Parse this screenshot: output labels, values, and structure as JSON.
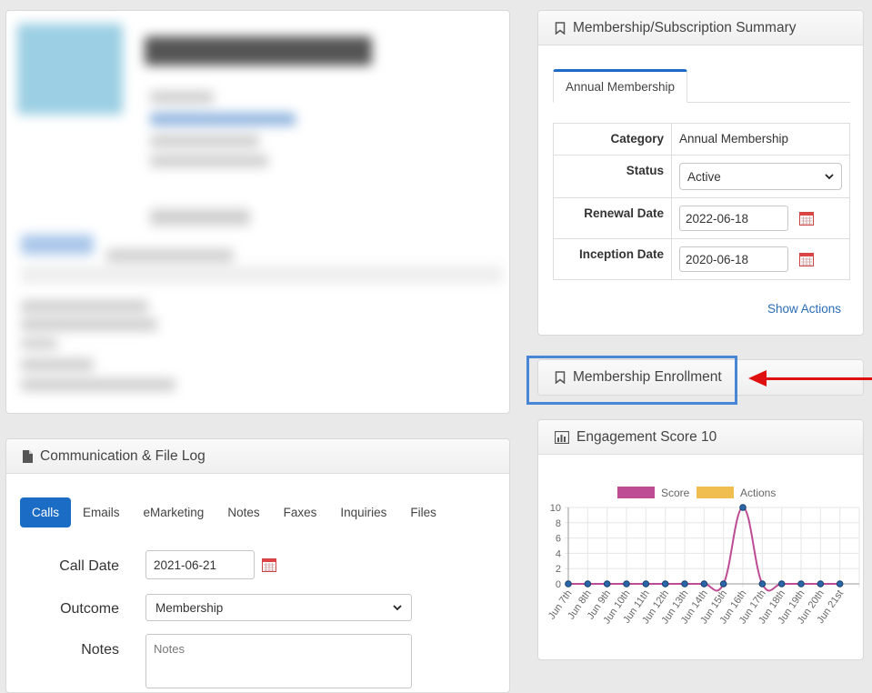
{
  "summary": {
    "title": "Membership/Subscription Summary",
    "tab": "Annual Membership",
    "rows": {
      "category": {
        "label": "Category",
        "value": "Annual Membership"
      },
      "status": {
        "label": "Status",
        "value": "Active"
      },
      "renewal": {
        "label": "Renewal Date",
        "value": "2022-06-18"
      },
      "inception": {
        "label": "Inception Date",
        "value": "2020-06-18"
      }
    },
    "show_actions": "Show Actions"
  },
  "enrollment": {
    "title": "Membership Enrollment"
  },
  "engagement": {
    "title": "Engagement Score 10"
  },
  "comm": {
    "title": "Communication & File Log",
    "tabs": [
      "Calls",
      "Emails",
      "eMarketing",
      "Notes",
      "Faxes",
      "Inquiries",
      "Files"
    ],
    "call_date_label": "Call Date",
    "call_date": "2021-06-21",
    "outcome_label": "Outcome",
    "outcome": "Membership",
    "notes_label": "Notes",
    "notes_placeholder": "Notes"
  },
  "colors": {
    "accent": "#1a6cc5",
    "score": "#bd4c95",
    "actions": "#f0bd4f",
    "highlight": "#4a86d6",
    "arrow": "#e01010"
  },
  "chart_data": {
    "type": "line",
    "x": [
      "Jun 7th",
      "Jun 8th",
      "Jun 9th",
      "Jun 10th",
      "Jun 11th",
      "Jun 12th",
      "Jun 13th",
      "Jun 14th",
      "Jun 15th",
      "Jun 16th",
      "Jun 17th",
      "Jun 18th",
      "Jun 19th",
      "Jun 20th",
      "Jun 21st"
    ],
    "series": [
      {
        "name": "Score",
        "color": "#bd4c95",
        "values": [
          0,
          0,
          0,
          0,
          0,
          0,
          0,
          0,
          0,
          10,
          0,
          0,
          0,
          0,
          0
        ]
      },
      {
        "name": "Actions",
        "color": "#f0bd4f",
        "values": []
      }
    ],
    "yticks": [
      0,
      2,
      4,
      6,
      8,
      10
    ],
    "ylim": [
      0,
      10
    ],
    "grid": true,
    "legend": "top"
  }
}
